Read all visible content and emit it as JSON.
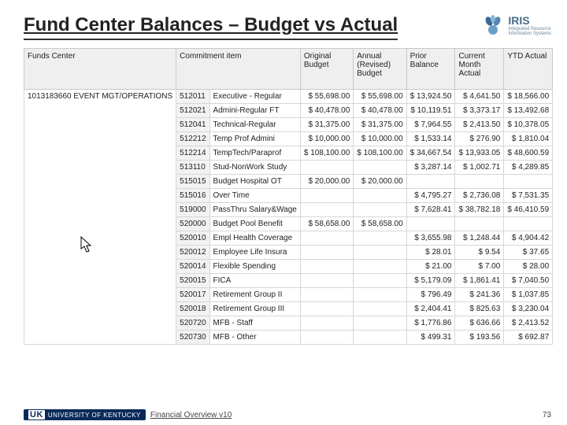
{
  "slide": {
    "title": "Fund Center Balances – Budget vs Actual",
    "page_number": "73",
    "footer_text": "Financial Overview v10",
    "uk_badge_prefix": "UK",
    "uk_badge_text": "UNIVERSITY OF KENTUCKY"
  },
  "logo": {
    "name": "IRIS",
    "sub1": "Integrated Resource",
    "sub2": "Information Systems"
  },
  "table": {
    "headers": [
      "Funds Center",
      "Commitment item",
      "",
      "Original Budget",
      "Annual (Revised) Budget",
      "Prior Balance",
      "Current Month Actual",
      "YTD Actual"
    ],
    "funds_center": "1013183660 EVENT MGT/OPERATIONS",
    "rows": [
      {
        "code": "512011",
        "desc": "Executive - Regular",
        "ob": "$ 55,698.00",
        "ab": "$ 55,698.00",
        "pb": "$ 13,924.50",
        "cm": "$ 4,641.50",
        "ytd": "$ 18,566.00"
      },
      {
        "code": "512021",
        "desc": "Admini-Regular FT",
        "ob": "$ 40,478.00",
        "ab": "$ 40,478.00",
        "pb": "$ 10,119.51",
        "cm": "$ 3,373.17",
        "ytd": "$ 13,492.68"
      },
      {
        "code": "512041",
        "desc": "Technical-Regular",
        "ob": "$ 31,375.00",
        "ab": "$ 31,375.00",
        "pb": "$ 7,964.55",
        "cm": "$ 2,413.50",
        "ytd": "$ 10,378.05"
      },
      {
        "code": "512212",
        "desc": "Temp Prof Admini",
        "ob": "$ 10,000.00",
        "ab": "$ 10,000.00",
        "pb": "$ 1,533.14",
        "cm": "$ 276.90",
        "ytd": "$ 1,810.04"
      },
      {
        "code": "512214",
        "desc": "TempTech/Paraprof",
        "ob": "$ 108,100.00",
        "ab": "$ 108,100.00",
        "pb": "$ 34,667.54",
        "cm": "$ 13,933.05",
        "ytd": "$ 48,600.59"
      },
      {
        "code": "513110",
        "desc": "Stud-NonWork Study",
        "ob": "",
        "ab": "",
        "pb": "$ 3,287.14",
        "cm": "$ 1,002.71",
        "ytd": "$ 4,289.85"
      },
      {
        "code": "515015",
        "desc": "Budget Hospital OT",
        "ob": "$ 20,000.00",
        "ab": "$ 20,000.00",
        "pb": "",
        "cm": "",
        "ytd": ""
      },
      {
        "code": "515016",
        "desc": "Over Time",
        "ob": "",
        "ab": "",
        "pb": "$ 4,795.27",
        "cm": "$ 2,736.08",
        "ytd": "$ 7,531.35"
      },
      {
        "code": "519000",
        "desc": "PassThru Salary&Wage",
        "ob": "",
        "ab": "",
        "pb": "$ 7,628.41",
        "cm": "$ 38,782.18",
        "ytd": "$ 46,410.59"
      },
      {
        "code": "520000",
        "desc": "Budget Pool Benefit",
        "ob": "$ 58,658.00",
        "ab": "$ 58,658.00",
        "pb": "",
        "cm": "",
        "ytd": ""
      },
      {
        "code": "520010",
        "desc": "Empl Health Coverage",
        "ob": "",
        "ab": "",
        "pb": "$ 3,655.98",
        "cm": "$ 1,248.44",
        "ytd": "$ 4,904.42"
      },
      {
        "code": "520012",
        "desc": "Employee Life Insura",
        "ob": "",
        "ab": "",
        "pb": "$ 28.01",
        "cm": "$ 9.54",
        "ytd": "$ 37.65"
      },
      {
        "code": "520014",
        "desc": "Flexible Spending",
        "ob": "",
        "ab": "",
        "pb": "$ 21.00",
        "cm": "$ 7.00",
        "ytd": "$ 28.00"
      },
      {
        "code": "520015",
        "desc": "FICA",
        "ob": "",
        "ab": "",
        "pb": "$ 5,179.09",
        "cm": "$ 1,861.41",
        "ytd": "$ 7,040.50"
      },
      {
        "code": "520017",
        "desc": "Retirement Group II",
        "ob": "",
        "ab": "",
        "pb": "$ 796.49",
        "cm": "$ 241.36",
        "ytd": "$ 1,037.85"
      },
      {
        "code": "520018",
        "desc": "Retirement Group III",
        "ob": "",
        "ab": "",
        "pb": "$ 2,404.41",
        "cm": "$ 825.63",
        "ytd": "$ 3,230.04"
      },
      {
        "code": "520720",
        "desc": "MFB - Staff",
        "ob": "",
        "ab": "",
        "pb": "$ 1,776.86",
        "cm": "$ 636.66",
        "ytd": "$ 2,413.52"
      },
      {
        "code": "520730",
        "desc": "MFB - Other",
        "ob": "",
        "ab": "",
        "pb": "$ 499.31",
        "cm": "$ 193.56",
        "ytd": "$ 692.87"
      }
    ]
  }
}
